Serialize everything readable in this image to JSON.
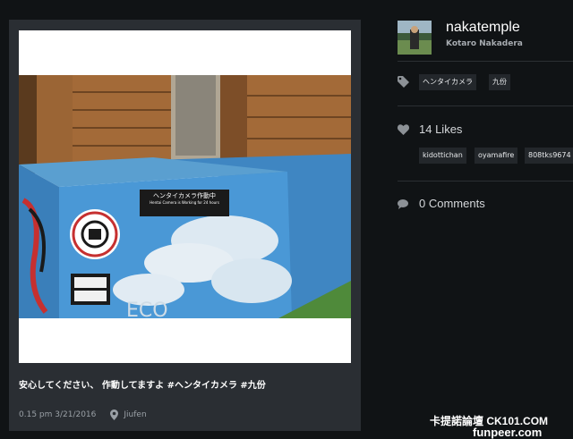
{
  "post": {
    "caption": "安心してください、 作動してますよ #ヘンタイカメラ #九份",
    "time": "0.15 pm 3/21/2016",
    "location": "Jiufen",
    "photo_sign_main": "ヘンタイカメラ作動中",
    "photo_sign_sub": "Hentai Camera is Working for 24 hours"
  },
  "user": {
    "username": "nakatemple",
    "real_name": "Kotaro Nakadera"
  },
  "tags": [
    "ヘンタイカメラ",
    "九份"
  ],
  "likes": {
    "label": "14 Likes",
    "users": [
      "kidottichan",
      "oyamafire",
      "808tks9674"
    ]
  },
  "comments": {
    "label": "0 Comments"
  },
  "watermark": {
    "line1": "卡提諾論壇 CK101.COM",
    "line2": "funpeer.com"
  },
  "icons": {
    "tag": "tag-icon",
    "heart": "heart-icon",
    "comment": "comment-bubble-icon",
    "location": "location-pin-icon"
  }
}
